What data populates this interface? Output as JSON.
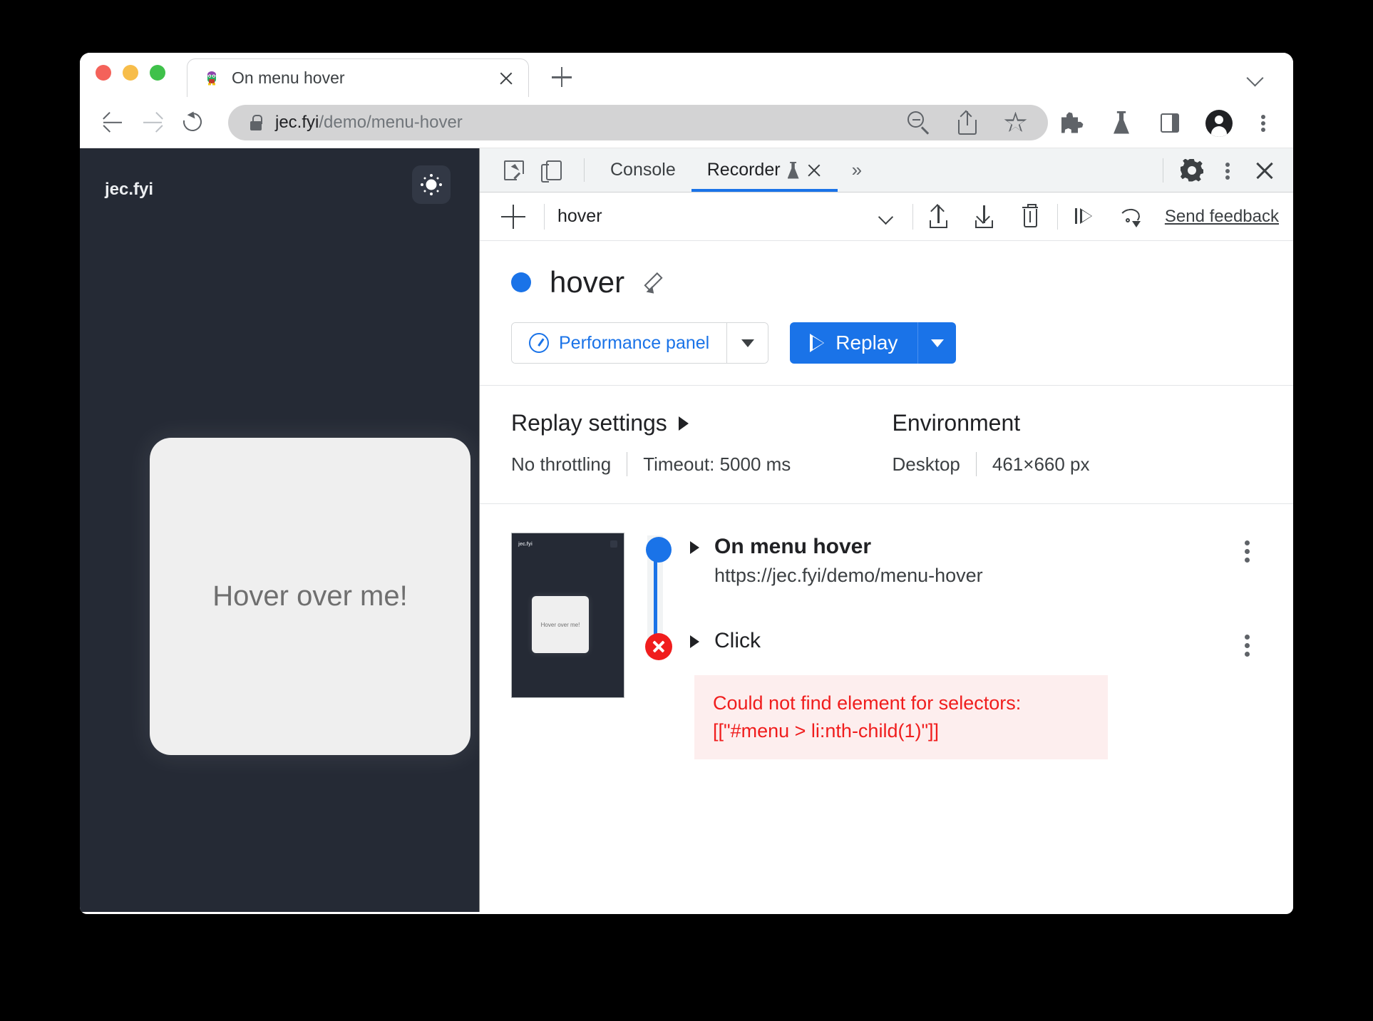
{
  "browser": {
    "tab": {
      "title": "On menu hover",
      "favicon": "page-favicon",
      "close_label": "close-tab"
    },
    "new_tab_label": "new-tab",
    "tab_search_label": "tab-search",
    "toolbar": {
      "back": "back",
      "forward": "forward",
      "reload": "reload",
      "url_host": "jec.fyi",
      "url_path": "/demo/menu-hover",
      "icons": [
        "zoom-out-icon",
        "share-icon",
        "bookmark-star-icon",
        "extensions-puzzle-icon",
        "experiments-flask-icon",
        "side-panel-icon",
        "profile-avatar-icon",
        "browser-menu-icon"
      ]
    }
  },
  "page": {
    "brand": "jec.fyi",
    "theme_toggle": "sun-icon",
    "card_text": "Hover over me!"
  },
  "devtools": {
    "tabs": [
      {
        "label": "Console",
        "active": false
      },
      {
        "label": "Recorder",
        "active": true
      }
    ],
    "more_tabs": "»",
    "settings_icon": "gear-icon",
    "menu_icon": "devtools-menu-icon",
    "close_icon": "close-devtools-icon",
    "recorder_toolbar": {
      "add_label": "add-recording",
      "recording_name": "hover",
      "export_label": "export-recording",
      "import_label": "import-recording",
      "delete_label": "delete-recording",
      "step_label": "step-replay",
      "undo_label": "replay-undo",
      "feedback_label": "Send feedback"
    },
    "recording": {
      "title": "hover",
      "edit_label": "edit-title",
      "perf_button": "Performance panel",
      "replay_button": "Replay"
    },
    "replay_settings": {
      "heading": "Replay settings",
      "throttling": "No throttling",
      "timeout": "Timeout: 5000 ms"
    },
    "environment": {
      "heading": "Environment",
      "device": "Desktop",
      "viewport": "461×660 px"
    },
    "thumbnail": {
      "brand": "jec.fyi",
      "card_text": "Hover over me!"
    },
    "steps": [
      {
        "title": "On menu hover",
        "url": "https://jec.fyi/demo/menu-hover",
        "status": "ok"
      },
      {
        "title": "Click",
        "url": "",
        "status": "error",
        "error": "Could not find element for selectors: [[\"#menu > li:nth-child(1)\"]]"
      }
    ]
  },
  "colors": {
    "accent_blue": "#1a73e8",
    "error_red": "#f01d1d",
    "error_bg": "#fdeeee",
    "page_bg": "#252a35",
    "card_bg": "#efefef"
  }
}
